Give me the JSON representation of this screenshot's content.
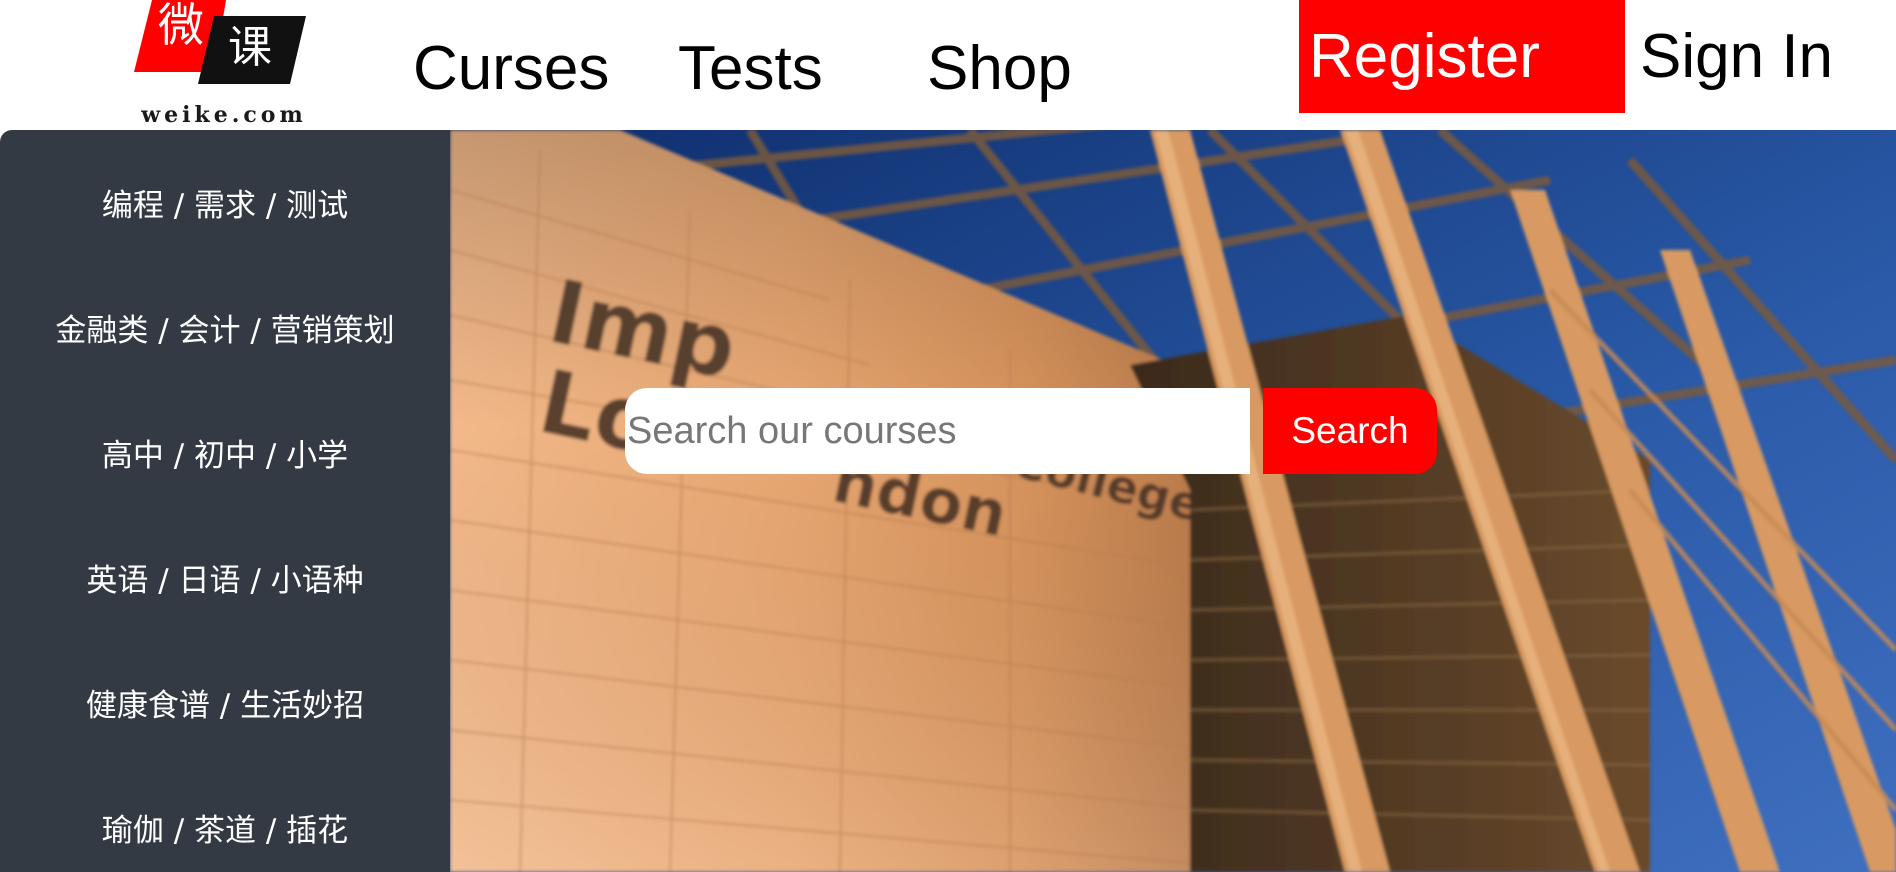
{
  "header": {
    "logo": {
      "glyph_1": "微",
      "glyph_2": "课",
      "domain": "weike.com",
      "colors": {
        "red": "#ff0000",
        "black": "#111111"
      }
    },
    "nav": {
      "courses": "Curses",
      "tests": "Tests",
      "shop": "Shop"
    },
    "register_label": "Register",
    "signin_label": "Sign In"
  },
  "sidebar": {
    "items": [
      {
        "label": "编程 / 需求 / 测试"
      },
      {
        "label": "金融类 / 会计 / 营销策划"
      },
      {
        "label": "高中 / 初中 / 小学"
      },
      {
        "label": "英语 / 日语 / 小语种"
      },
      {
        "label": "健康食谱 / 生活妙招"
      },
      {
        "label": "瑜伽 / 茶道 / 插花"
      }
    ],
    "background": "#333a44"
  },
  "hero": {
    "background_image": "campus-building-photo",
    "search": {
      "placeholder": "Search our courses",
      "value": "",
      "button_label": "Search"
    }
  },
  "colors": {
    "accent": "#ff0000",
    "sidebar_bg": "#333a44",
    "text_dark": "#000000"
  }
}
